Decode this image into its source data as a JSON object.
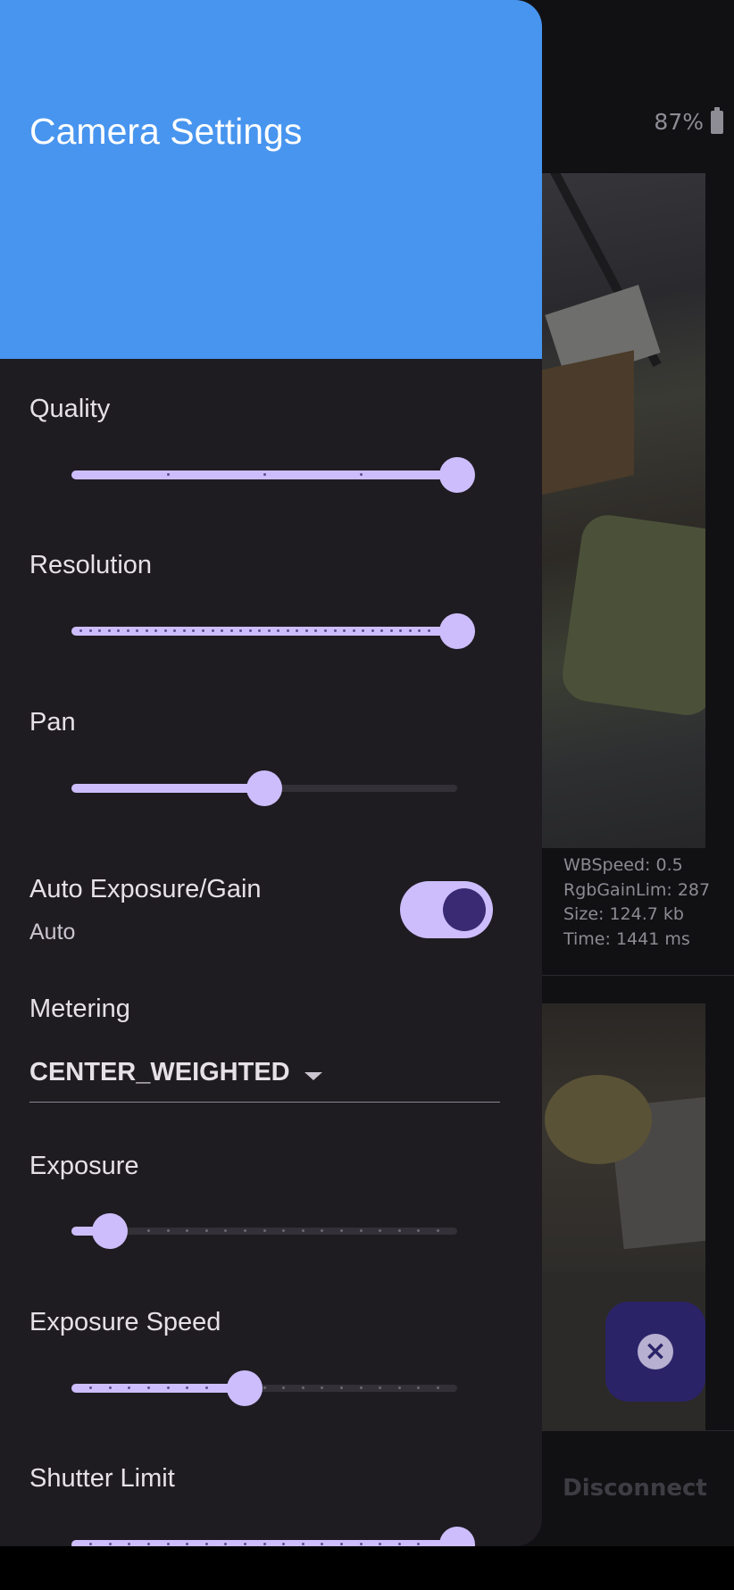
{
  "status_bar": {
    "battery_text": "87%"
  },
  "camera_info": {
    "lines": [
      "WBSpeed: 0.5",
      "RgbGainLim: 287",
      "Size: 124.7 kb",
      "Time: 1441 ms"
    ]
  },
  "bottom_bar": {
    "disconnect_label": "Disconnect"
  },
  "fab": {
    "icon": "close-icon",
    "glyph": "×"
  },
  "drawer": {
    "title": "Camera Settings",
    "header_color": "#4895ef",
    "accent_color": "#cdbdfc",
    "settings": {
      "quality": {
        "label": "Quality",
        "value_fraction": 1.0,
        "divisions": 4
      },
      "resolution": {
        "label": "Resolution",
        "value_fraction": 1.0,
        "divisions": 41
      },
      "pan": {
        "label": "Pan",
        "value_fraction": 0.5
      },
      "auto_exposure": {
        "label": "Auto Exposure/Gain",
        "sublabel": "Auto",
        "enabled": true
      },
      "metering": {
        "label": "Metering",
        "selected": "CENTER_WEIGHTED"
      },
      "exposure": {
        "label": "Exposure",
        "value_fraction": 0.1,
        "divisions": 20
      },
      "exposure_speed": {
        "label": "Exposure Speed",
        "value_fraction": 0.45,
        "divisions": 20
      },
      "shutter_limit": {
        "label": "Shutter Limit",
        "value_fraction": 1.0,
        "divisions": 20
      }
    }
  }
}
